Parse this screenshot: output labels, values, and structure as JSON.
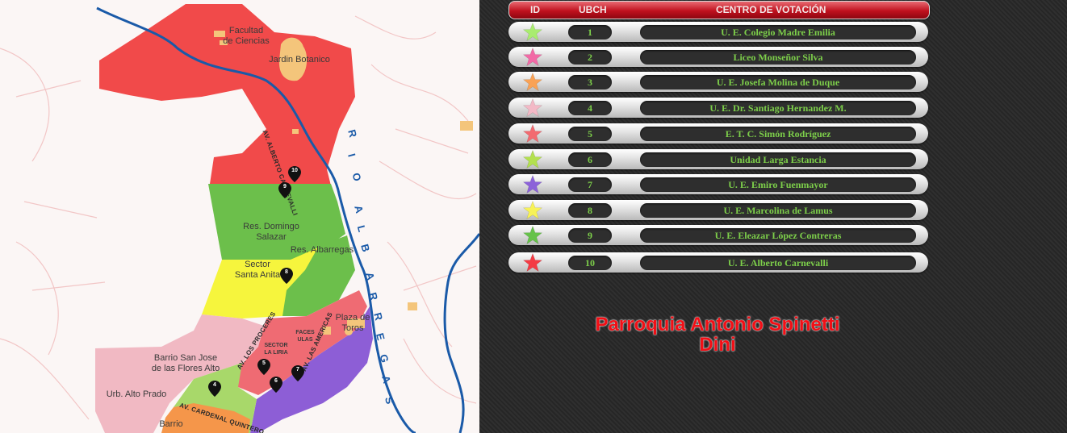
{
  "map": {
    "labels": {
      "facultad": "Facultad\nde Ciencias",
      "jardin": "Jardin Botanico",
      "domingo": "Res. Domingo\nSalazar",
      "albarregas_res": "Res. Albarregas",
      "santa_anita": "Sector\nSanta Anita",
      "plaza_toros": "Plaza de\nToros",
      "faces": "FACES\nULAS",
      "liria": "SECTOR\nLA LIRIA",
      "san_jose": "Barrio San Jose\nde las Flores Alto",
      "alto_prado": "Urb. Alto Prado",
      "barrio": "Barrio"
    },
    "streets": {
      "carnevalli": "AV. ALBERTO CARNEVALLI",
      "proceres": "AV. LOS PROCERES",
      "americas": "AV. LAS AMERICAS",
      "quintero": "AV. CARDENAL QUINTERO"
    },
    "river_letters": [
      "R",
      "I",
      "O",
      "A",
      "L",
      "B",
      "A",
      "R",
      "R",
      "E",
      "G",
      "A",
      "S"
    ],
    "pins": [
      "10",
      "9",
      "8",
      "5",
      "6",
      "7",
      "4"
    ],
    "zone_colors": {
      "red": "#f14a4a",
      "green": "#6cbf4b",
      "yellow": "#f6f53d",
      "pink": "#f1b9c3",
      "salmon": "#ef6b73",
      "purple": "#8d5ed6",
      "orange": "#f5964a",
      "light_green": "#a8d86a",
      "river": "#1a5aa8"
    }
  },
  "table": {
    "headers": {
      "id": "ID",
      "ubch": "UBCH",
      "centro": "CENTRO DE VOTACIÓN"
    },
    "rows": [
      {
        "id": "1",
        "name": "U. E. Colegio Madre Emilia",
        "star_color": "#a9ec6f"
      },
      {
        "id": "2",
        "name": "Liceo Monseñor Silva",
        "star_color": "#f26aa6"
      },
      {
        "id": "3",
        "name": "U. E. Josefa Molina de Duque",
        "star_color": "#f9a256"
      },
      {
        "id": "4",
        "name": "U. E. Dr. Santiago Hernandez M.",
        "star_color": "#f3b9c6"
      },
      {
        "id": "5",
        "name": "E. T. C. Simón Rodríguez",
        "star_color": "#f26a70"
      },
      {
        "id": "6",
        "name": "Unidad Larga Estancia",
        "star_color": "#b3e04f"
      },
      {
        "id": "7",
        "name": "U. E. Emiro Fuenmayor",
        "star_color": "#8c62d9"
      },
      {
        "id": "8",
        "name": "U. E. Marcolina de Lamus",
        "star_color": "#f7f257"
      },
      {
        "id": "9",
        "name": "U. E. Eleazar López Contreras",
        "star_color": "#66c24a"
      },
      {
        "id": "10",
        "name": "U. E. Alberto Carnevalli",
        "star_color": "#f43b44"
      }
    ]
  },
  "title": "Parroquia Antonio Spinetti\nDini"
}
